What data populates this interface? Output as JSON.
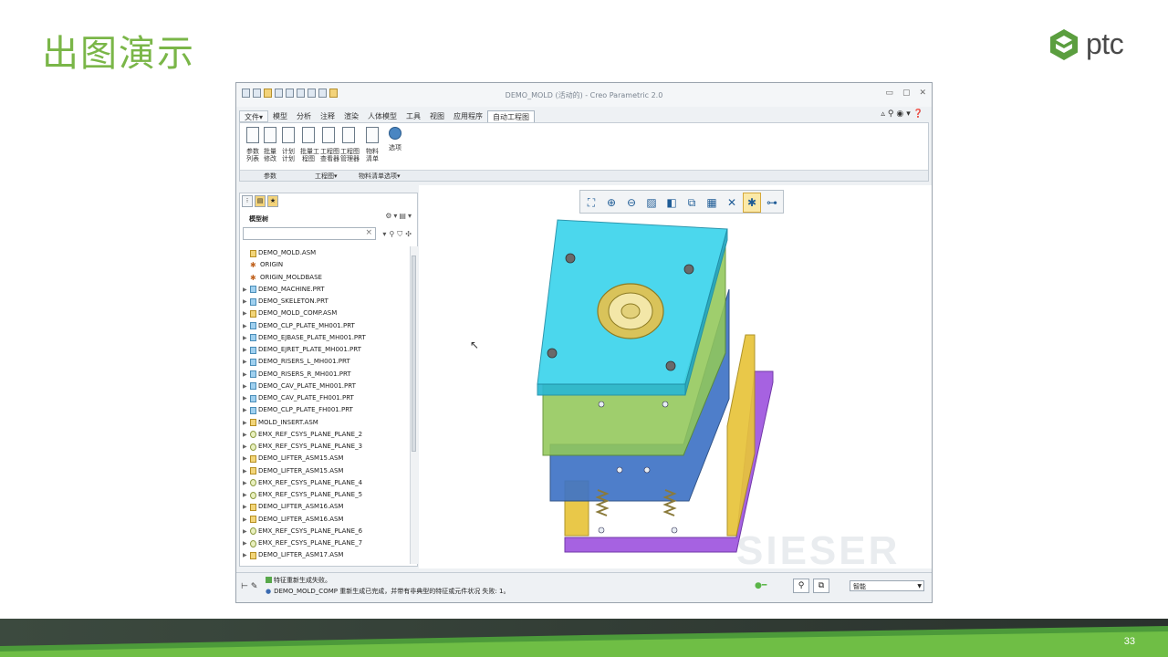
{
  "slide": {
    "title": "出图演示",
    "logo_text": "ptc",
    "page_number": "33"
  },
  "window": {
    "title": "DEMO_MOLD (活动的) - Creo Parametric 2.0"
  },
  "menu": {
    "tabs": [
      "文件▾",
      "模型",
      "分析",
      "注释",
      "渲染",
      "人体模型",
      "工具",
      "视图",
      "应用程序",
      "自动工程图"
    ],
    "active_tab": "自动工程图"
  },
  "ribbon": {
    "buttons": [
      "参数\n列表",
      "批量\n修改",
      "计划\n计划",
      "批量工\n程图",
      "工程图\n查看器",
      "工程图\n管理器",
      "物料\n清单",
      "选项"
    ],
    "groups": [
      "参数",
      "工程图▾",
      "物料清单",
      "选项▾"
    ]
  },
  "model_tree": {
    "header": "模型树",
    "filter_placeholder": "",
    "items": [
      {
        "label": "DEMO_MOLD.ASM",
        "type": "asm",
        "expand": ""
      },
      {
        "label": "ORIGIN",
        "type": "csys",
        "expand": ""
      },
      {
        "label": "ORIGIN_MOLDBASE",
        "type": "csys",
        "expand": ""
      },
      {
        "label": "DEMO_MACHINE.PRT",
        "type": "prt",
        "expand": "▶"
      },
      {
        "label": "DEMO_SKELETON.PRT",
        "type": "prt",
        "expand": "▶"
      },
      {
        "label": "DEMO_MOLD_COMP.ASM",
        "type": "asm",
        "expand": "▶"
      },
      {
        "label": "DEMO_CLP_PLATE_MH001.PRT",
        "type": "prt",
        "expand": "▶"
      },
      {
        "label": "DEMO_EJBASE_PLATE_MH001.PRT",
        "type": "prt",
        "expand": "▶"
      },
      {
        "label": "DEMO_EJRET_PLATE_MH001.PRT",
        "type": "prt",
        "expand": "▶"
      },
      {
        "label": "DEMO_RISERS_L_MH001.PRT",
        "type": "prt",
        "expand": "▶"
      },
      {
        "label": "DEMO_RISERS_R_MH001.PRT",
        "type": "prt",
        "expand": "▶"
      },
      {
        "label": "DEMO_CAV_PLATE_MH001.PRT",
        "type": "prt",
        "expand": "▶"
      },
      {
        "label": "DEMO_CAV_PLATE_FH001.PRT",
        "type": "prt",
        "expand": "▶"
      },
      {
        "label": "DEMO_CLP_PLATE_FH001.PRT",
        "type": "prt",
        "expand": "▶"
      },
      {
        "label": "MOLD_INSERT.ASM",
        "type": "asm",
        "expand": "▶"
      },
      {
        "label": "EMX_REF_CSYS_PLANE_PLANE_2",
        "type": "ref",
        "expand": "▶"
      },
      {
        "label": "EMX_REF_CSYS_PLANE_PLANE_3",
        "type": "ref",
        "expand": "▶"
      },
      {
        "label": "DEMO_LIFTER_ASM15.ASM",
        "type": "asm",
        "expand": "▶"
      },
      {
        "label": "DEMO_LIFTER_ASM15.ASM",
        "type": "asm",
        "expand": "▶"
      },
      {
        "label": "EMX_REF_CSYS_PLANE_PLANE_4",
        "type": "ref",
        "expand": "▶"
      },
      {
        "label": "EMX_REF_CSYS_PLANE_PLANE_5",
        "type": "ref",
        "expand": "▶"
      },
      {
        "label": "DEMO_LIFTER_ASM16.ASM",
        "type": "asm",
        "expand": "▶"
      },
      {
        "label": "DEMO_LIFTER_ASM16.ASM",
        "type": "asm",
        "expand": "▶"
      },
      {
        "label": "EMX_REF_CSYS_PLANE_PLANE_6",
        "type": "ref",
        "expand": "▶"
      },
      {
        "label": "EMX_REF_CSYS_PLANE_PLANE_7",
        "type": "ref",
        "expand": "▶"
      },
      {
        "label": "DEMO_LIFTER_ASM17.ASM",
        "type": "asm",
        "expand": "▶"
      }
    ]
  },
  "status": {
    "messages": [
      "特征重新生成失败。",
      "DEMO_MOLD_COMP 重新生成已完成，并带有非典型的特征或元件状况 失败: 1。"
    ],
    "filter_value": "智能"
  },
  "viewport": {
    "watermark": "SIESER"
  },
  "colors": {
    "title_green": "#7ab648",
    "top_plate": "#3cd4ec",
    "a_plate": "#92c85a",
    "b_plate": "#3f74c6",
    "risers": "#e8c43a",
    "clamp_plate": "#a25ae0"
  }
}
